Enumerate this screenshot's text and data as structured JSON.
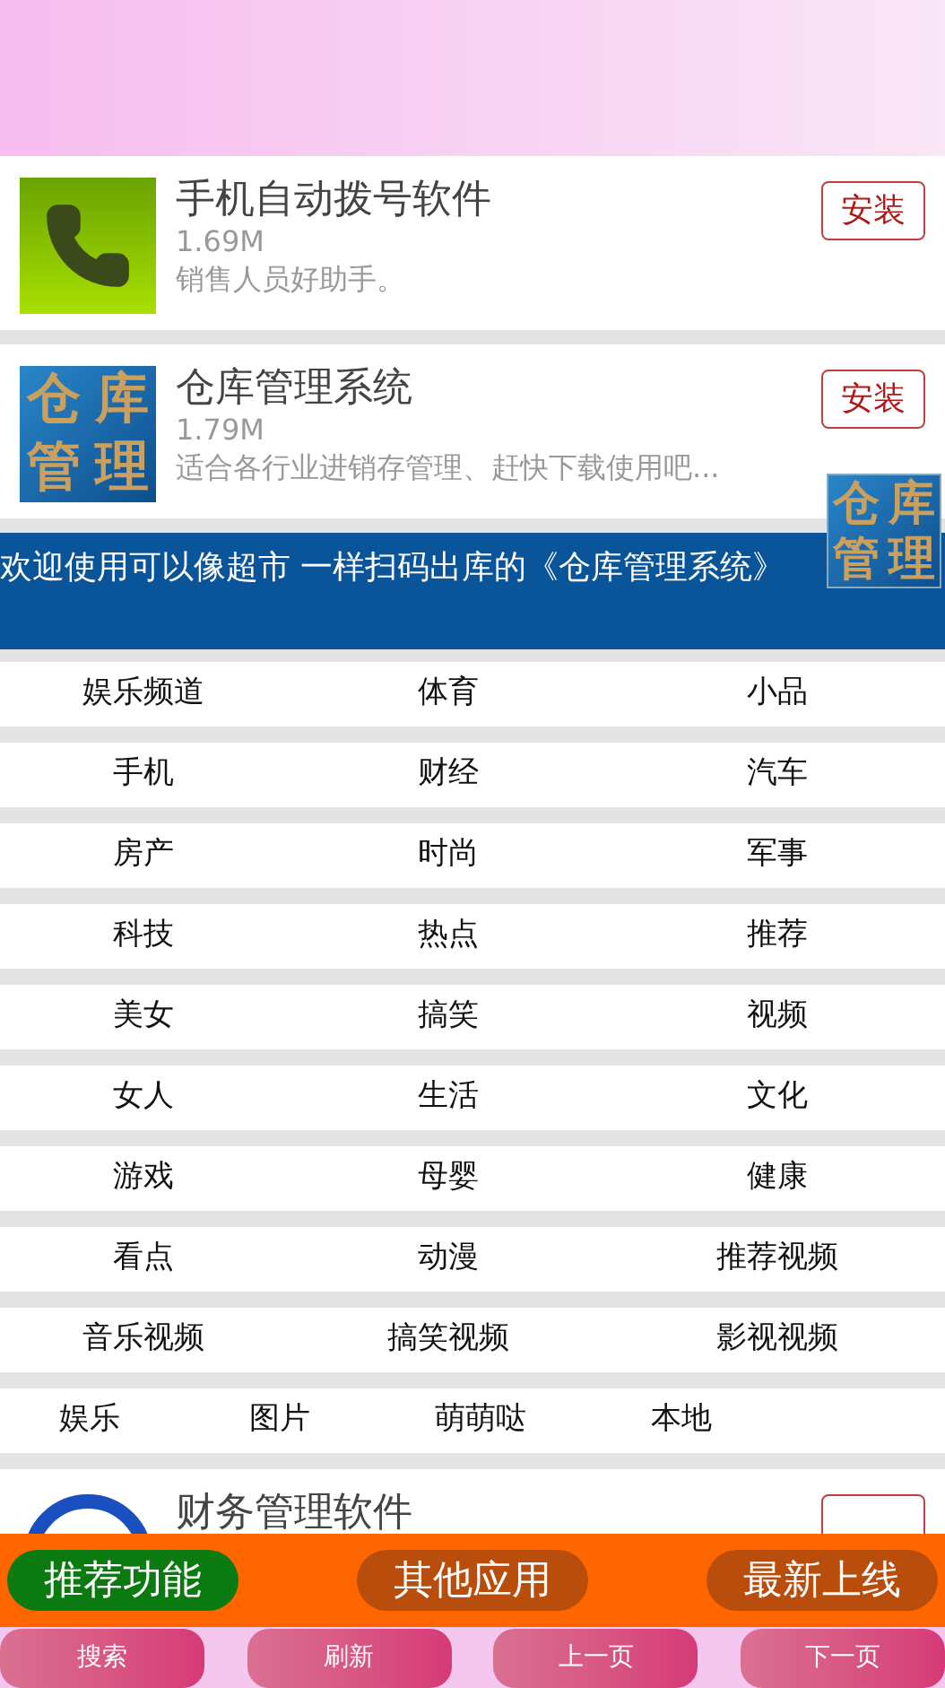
{
  "apps": [
    {
      "kind": "phone",
      "title": "手机自动拨号软件",
      "size": "1.69M",
      "description": "销售人员好助手。",
      "button": "安装"
    },
    {
      "kind": "logo",
      "logo_text": [
        "仓",
        "库",
        "管",
        "理"
      ],
      "title": "仓库管理系统",
      "size": "1.79M",
      "description": "适合各行业进销存管理、赶快下载使用吧...",
      "button": "安装"
    },
    {
      "kind": "ring",
      "title": "财务管理软件"
    }
  ],
  "banner": {
    "text": "欢迎使用可以像超市 一样扫码出库的《仓库管理系统》",
    "logo_text": [
      "仓",
      "库",
      "管",
      "理"
    ]
  },
  "categories": [
    [
      "娱乐频道",
      "体育",
      "小品"
    ],
    [
      "手机",
      "财经",
      "汽车"
    ],
    [
      "房产",
      "时尚",
      "军事"
    ],
    [
      "科技",
      "热点",
      "推荐"
    ],
    [
      "美女",
      "搞笑",
      "视频"
    ],
    [
      "女人",
      "生活",
      "文化"
    ],
    [
      "游戏",
      "母婴",
      "健康"
    ],
    [
      "看点",
      "动漫",
      "推荐视频"
    ],
    [
      "音乐视频",
      "搞笑视频",
      "影视视频"
    ],
    [
      "娱乐",
      "图片",
      "萌萌哒",
      "本地"
    ]
  ],
  "tabs": [
    {
      "label": "推荐功能",
      "selected": true
    },
    {
      "label": "其他应用",
      "selected": false
    },
    {
      "label": "最新上线",
      "selected": false
    }
  ],
  "nav_buttons": [
    "搜索",
    "刷新",
    "上一页",
    "下一页"
  ]
}
